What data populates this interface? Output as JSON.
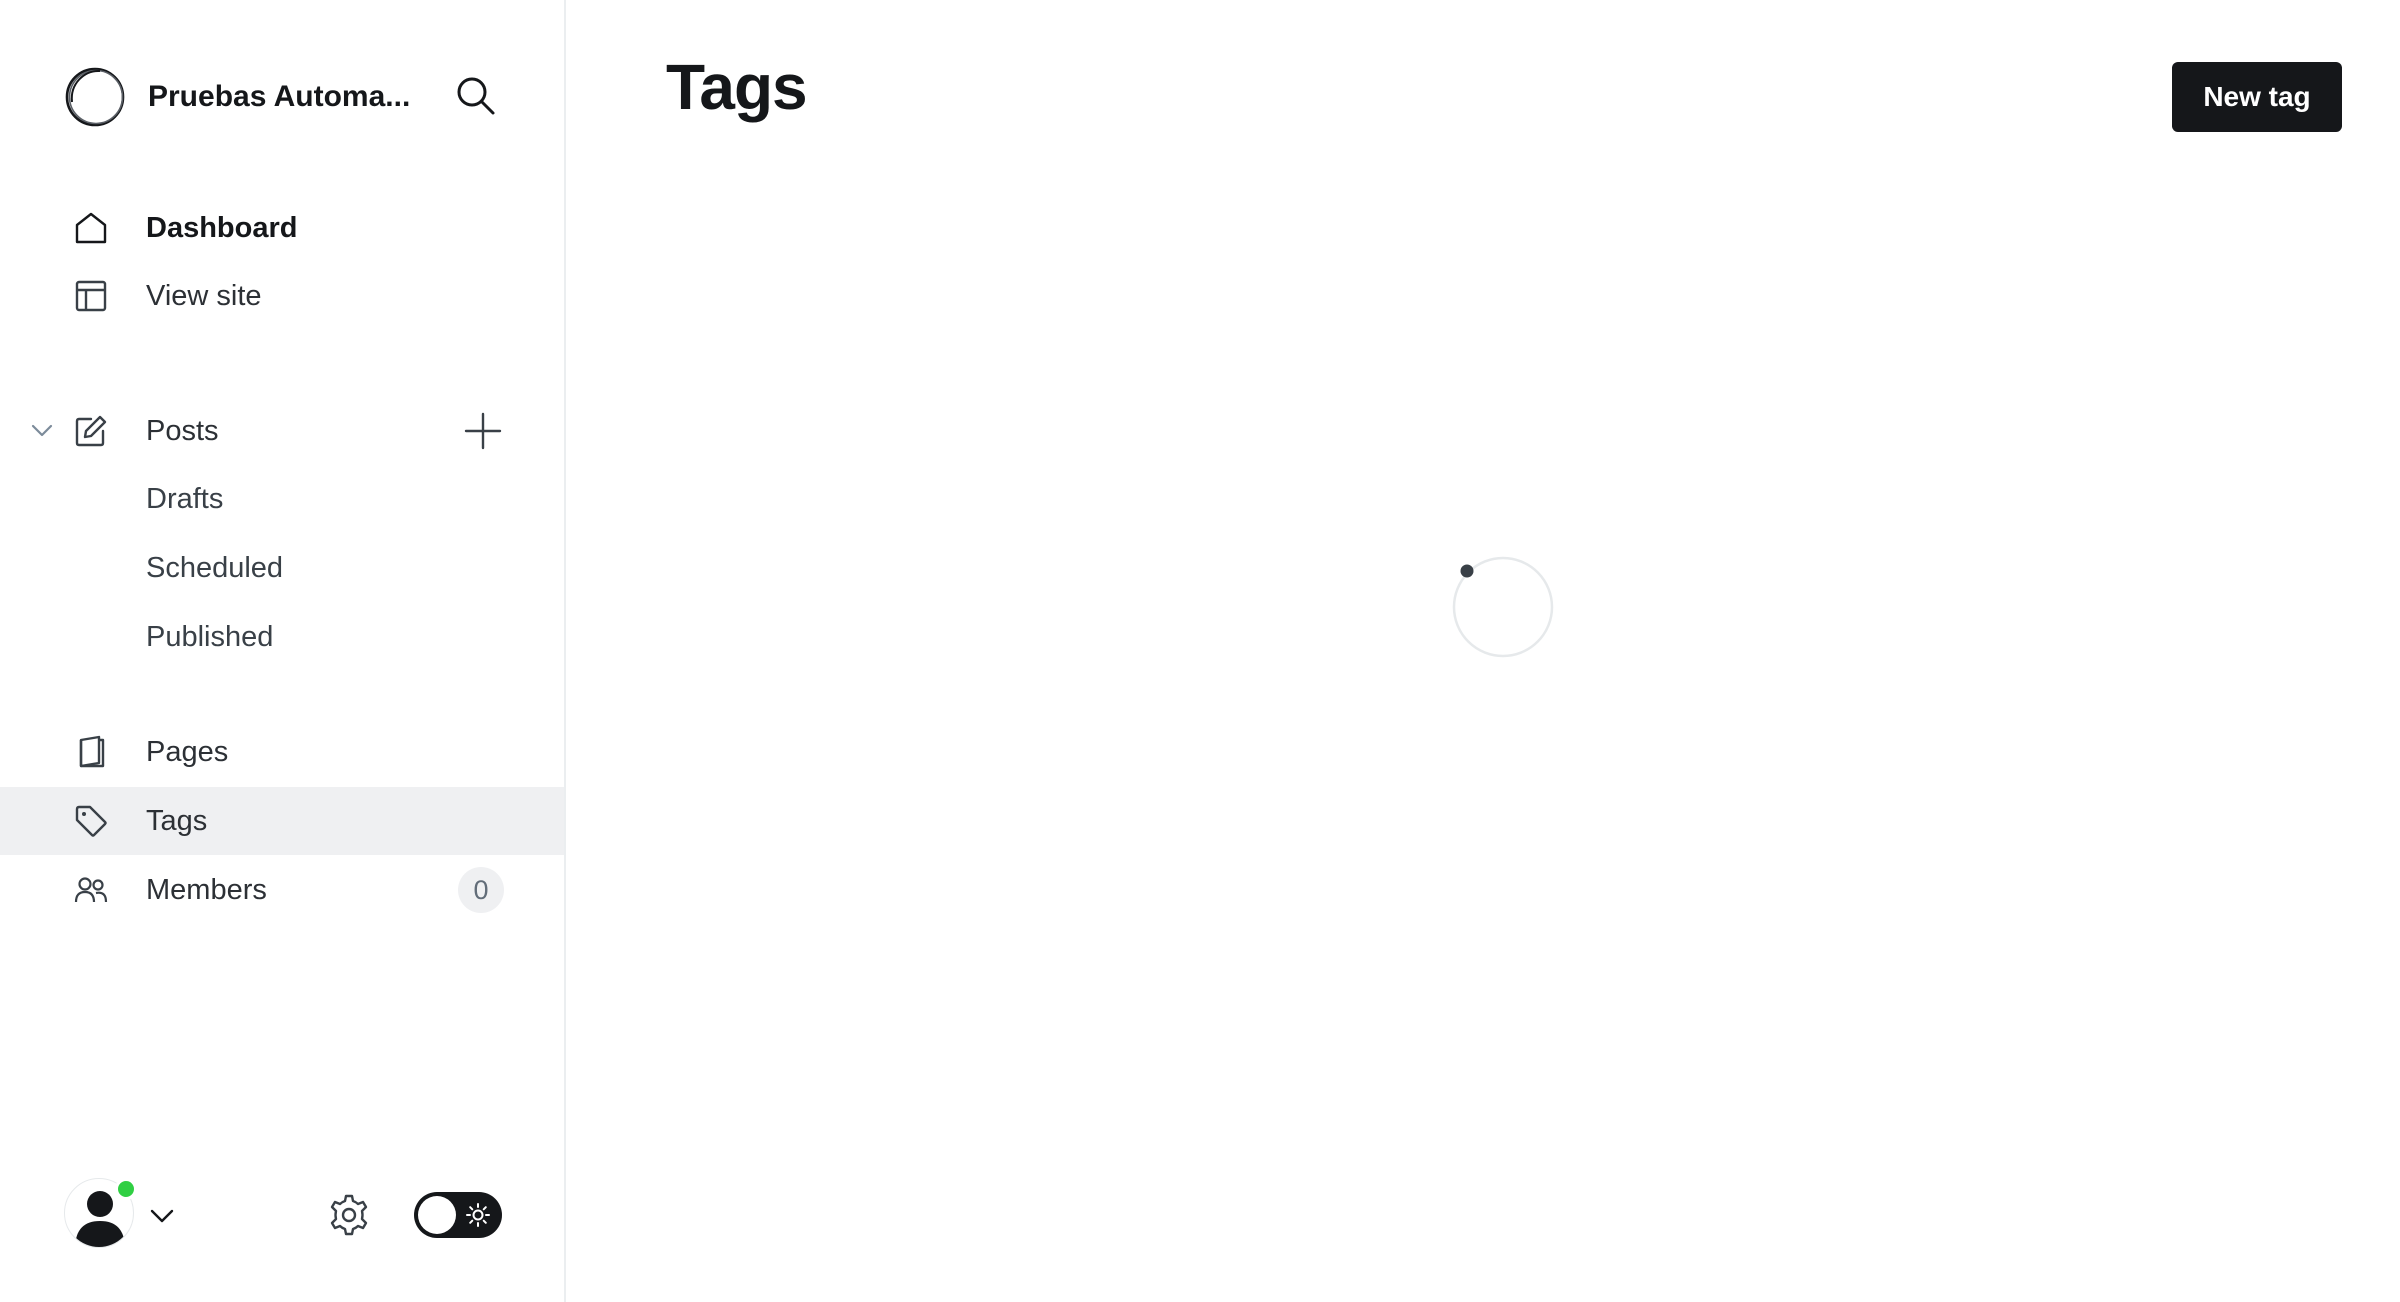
{
  "sidebar": {
    "site_title": "Pruebas Automa...",
    "nav": {
      "dashboard": "Dashboard",
      "view_site": "View site",
      "posts": "Posts",
      "drafts": "Drafts",
      "scheduled": "Scheduled",
      "published": "Published",
      "pages": "Pages",
      "tags": "Tags",
      "members": "Members",
      "members_count": "0"
    },
    "icons": {
      "logo": "site-logo-icon",
      "search": "search-icon",
      "dashboard": "home-icon",
      "view_site": "layout-icon",
      "posts": "edit-icon",
      "pages": "page-icon",
      "tags": "tag-icon",
      "members": "members-icon",
      "settings": "gear-icon",
      "theme": "sun-icon"
    },
    "active_item": "Tags"
  },
  "main": {
    "title": "Tags",
    "new_tag_label": "New tag",
    "loading": true
  },
  "colors": {
    "accent": "#15171a",
    "online": "#30cf43",
    "active_bg": "#eff0f2"
  }
}
